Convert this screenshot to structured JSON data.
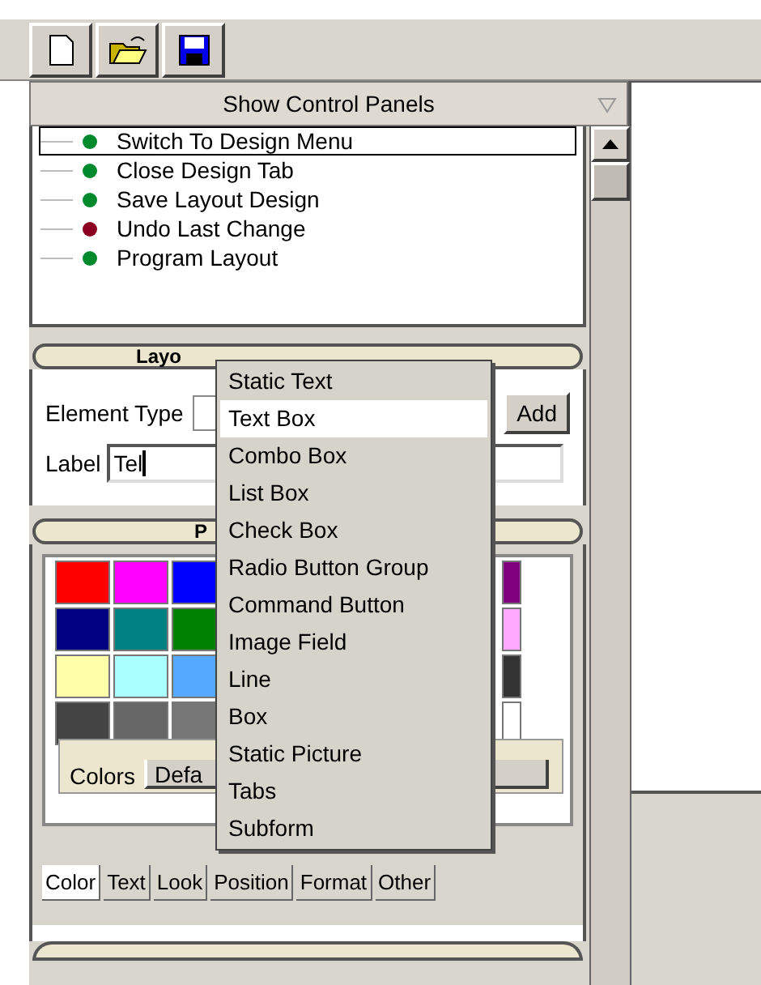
{
  "toolbar": {
    "buttons": [
      {
        "kind": "new"
      },
      {
        "kind": "open"
      },
      {
        "kind": "save"
      }
    ]
  },
  "panel_header": {
    "title": "Show Control Panels"
  },
  "tree": {
    "items": [
      {
        "label": "Switch To Design Menu",
        "color": "#008a2e",
        "selected": true
      },
      {
        "label": "Close Design Tab",
        "color": "#008a2e",
        "selected": false
      },
      {
        "label": "Save Layout Design",
        "color": "#008a2e",
        "selected": false
      },
      {
        "label": "Undo Last Change",
        "color": "#8b0020",
        "selected": false
      },
      {
        "label": "Program Layout",
        "color": "#008a2e",
        "selected": false
      }
    ]
  },
  "adder": {
    "header": "Layo",
    "element_type_label": "Element Type",
    "add_button": "Add",
    "label_label": "Label",
    "label_value": "Tel"
  },
  "palette": {
    "header": "P",
    "left_rows": [
      [
        {
          "color": "#ff0000"
        },
        {
          "color": "#ff00ff"
        },
        {
          "color": "#0000ff"
        }
      ],
      [
        {
          "color": "#000080"
        },
        {
          "color": "#008080"
        },
        {
          "color": "#008000"
        }
      ],
      [
        {
          "color": "#ffffaa"
        },
        {
          "color": "#aaffff"
        },
        {
          "color": "#55aaff"
        }
      ],
      [
        {
          "color": "#444444"
        },
        {
          "color": "#666666"
        },
        {
          "color": "#777777"
        }
      ]
    ],
    "right_column": [
      {
        "color": "#800080"
      },
      {
        "color": "#ffaaff"
      },
      {
        "color": "#333333"
      },
      {
        "color": "#ffffff"
      }
    ],
    "colors_label": "Colors",
    "colors_value": "Defa"
  },
  "tabs": [
    {
      "label": "Color",
      "selected": true
    },
    {
      "label": "Text",
      "selected": false
    },
    {
      "label": "Look",
      "selected": false
    },
    {
      "label": "Position",
      "selected": false
    },
    {
      "label": "Format",
      "selected": false
    },
    {
      "label": "Other",
      "selected": false
    }
  ],
  "menu": {
    "items": [
      {
        "label": "Static Text",
        "selected": false
      },
      {
        "label": "Text Box",
        "selected": true
      },
      {
        "label": "Combo Box",
        "selected": false
      },
      {
        "label": "List Box",
        "selected": false
      },
      {
        "label": "Check Box",
        "selected": false
      },
      {
        "label": "Radio Button Group",
        "selected": false
      },
      {
        "label": "Command Button",
        "selected": false
      },
      {
        "label": "Image Field",
        "selected": false
      },
      {
        "label": "Line",
        "selected": false
      },
      {
        "label": "Box",
        "selected": false
      },
      {
        "label": "Static Picture",
        "selected": false
      },
      {
        "label": "Tabs",
        "selected": false
      },
      {
        "label": "Subform",
        "selected": false
      }
    ]
  }
}
